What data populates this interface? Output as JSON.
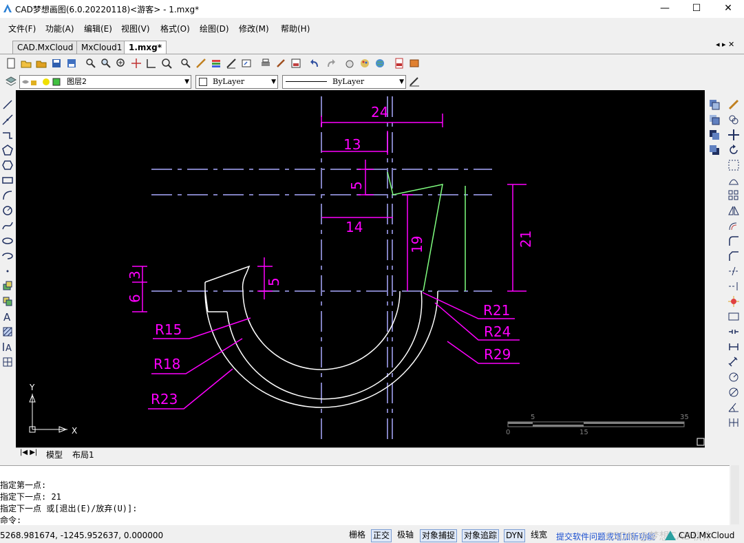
{
  "window": {
    "title": "CAD梦想画图(6.0.20220118)<游客> - 1.mxg*",
    "minimize": "—",
    "maximize": "☐",
    "close": "✕"
  },
  "menu": [
    "文件(F)",
    "功能(A)",
    "编辑(E)",
    "视图(V)",
    "格式(O)",
    "绘图(D)",
    "修改(M)",
    "帮助(H)"
  ],
  "tabs": [
    "CAD.MxCloud",
    "MxCloud1",
    "1.mxg*"
  ],
  "tab_nav": "◂ ▸ ✕",
  "layer_bar": {
    "layer": "图层2",
    "color": "ByLayer",
    "linetype": "ByLayer"
  },
  "drawing": {
    "dims": [
      "24",
      "13",
      "5",
      "14",
      "19",
      "21",
      "5",
      "3",
      "6",
      "R21",
      "R24",
      "R29",
      "R15",
      "R18",
      "R23"
    ],
    "scale": {
      "labels_top": [
        "5",
        "35"
      ],
      "labels_bottom": [
        "0",
        "15"
      ]
    },
    "ucs": {
      "y": "Y",
      "x": "X"
    }
  },
  "layout_tabs": [
    "模型",
    "布局1"
  ],
  "command": {
    "lines": [
      "指定第一点:",
      "指定下一点: 21",
      "指定下一点 或[退出(E)/放弃(U)]:"
    ],
    "prompt": "命令:"
  },
  "status": {
    "coords": "5268.981674, -1245.952637, 0.000000",
    "buttons": [
      "栅格",
      "正交",
      "极轴",
      "对象捕捉",
      "对象追踪",
      "DYN",
      "线宽"
    ],
    "buttons_on": [
      false,
      true,
      false,
      true,
      true,
      true,
      false
    ],
    "link": "提交软件问题或增加新功能",
    "brand": "CAD.MxCloud",
    "watermark": "CSDN @梦想CAD软件"
  },
  "colors": {
    "magenta": "#ff00ff",
    "dashed": "#8080c0",
    "green": "#80ff80",
    "white": "#ffffff"
  }
}
